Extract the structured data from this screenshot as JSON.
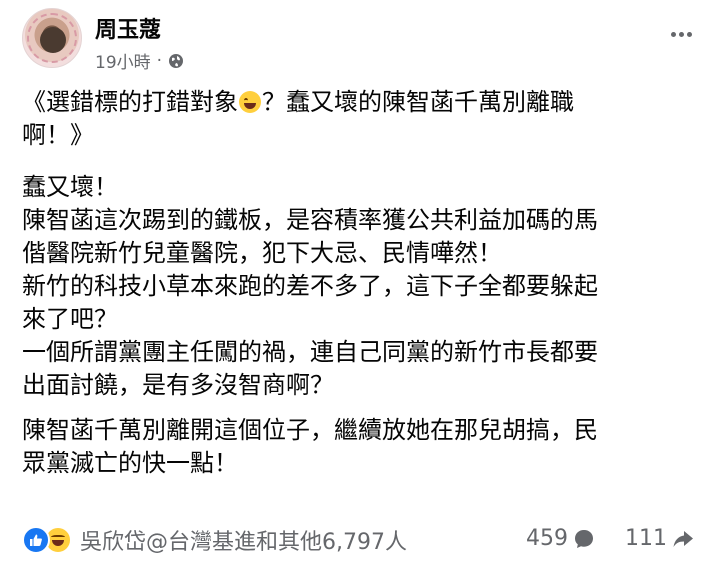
{
  "post": {
    "author": "周玉蔻",
    "time": "19小時",
    "separator": "·",
    "privacy_icon": "globe-icon",
    "more_icon": "more-options-icon"
  },
  "content": {
    "title_part1": "《選錯標的打錯對象",
    "title_emoji": "grinning-squinting-face-emoji",
    "title_part2": "？蠢又壞的陳智菡千萬別離職",
    "title_line2": "啊！》",
    "lines": [
      "蠢又壞！",
      "陳智菡這次踢到的鐵板，是容積率獲公共利益加碼的馬",
      "偕醫院新竹兒童醫院，犯下大忌、民情嘩然！",
      "新竹的科技小草本來跑的差不多了，這下子全都要躲起",
      "來了吧？",
      "一個所謂黨團主任闖的禍，連自己同黨的新竹市長都要",
      "出面討饒，是有多沒智商啊？"
    ],
    "closing_lines": [
      "陳智菡千萬別離開這個位子，繼續放她在那兒胡搞，民",
      "眾黨滅亡的快一點！"
    ]
  },
  "footer": {
    "reactions_text": "吳欣岱@台灣基進和其他6,797人",
    "reaction_icons": [
      "like-icon",
      "haha-icon"
    ],
    "comment_count": "459",
    "share_count": "111",
    "accent_color": "#1877f2",
    "muted_color": "#65676b"
  }
}
